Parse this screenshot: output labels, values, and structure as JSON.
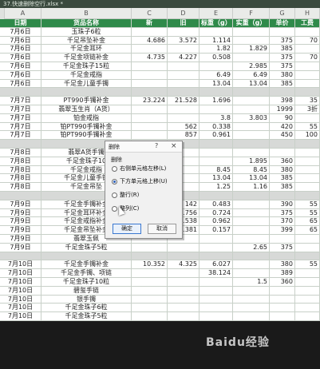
{
  "window": {
    "title": "37.快速删除空行.xlsx *"
  },
  "columns": [
    "A",
    "B",
    "C",
    "D",
    "E",
    "F",
    "G",
    "H"
  ],
  "header": [
    "日期",
    "货品名称",
    "新",
    "旧",
    "标重（g）",
    "实重（g）",
    "单价",
    "工费"
  ],
  "rows": [
    [
      "7月6日",
      "玉珠子6粒",
      "",
      "",
      "",
      "",
      "",
      ""
    ],
    [
      "7月6日",
      "千足吊坠补金",
      "4.686",
      "3.572",
      "1.114",
      "",
      "375",
      "70"
    ],
    [
      "7月6日",
      "千足金耳环",
      "",
      "",
      "1.82",
      "1.829",
      "385",
      ""
    ],
    [
      "7月6日",
      "千足金项链补金",
      "4.735",
      "4.227",
      "0.508",
      "",
      "375",
      "70"
    ],
    [
      "7月6日",
      "千足金珠子15粒",
      "",
      "",
      "",
      "2.985",
      "375",
      ""
    ],
    [
      "7月6日",
      "千足金戒指",
      "",
      "",
      "6.49",
      "6.49",
      "380",
      ""
    ],
    [
      "7月6日",
      "千足金儿童手镯",
      "",
      "",
      "13.04",
      "13.04",
      "385",
      ""
    ],
    [],
    [
      "7月7日",
      "PT990手镯补金",
      "23.224",
      "21.528",
      "1.696",
      "",
      "398",
      "35"
    ],
    [
      "7月7日",
      "翡翠玉生肖（A货）",
      "",
      "",
      "",
      "",
      "1999",
      "3折"
    ],
    [
      "7月7日",
      "铂金戒指",
      "",
      "",
      "3.8",
      "3.803",
      "90",
      ""
    ],
    [
      "7月7日",
      "铂PT990手镯补金",
      "",
      "562",
      "0.338",
      "",
      "420",
      "55"
    ],
    [
      "7月7日",
      "铂PT990手镯补金",
      "",
      "857",
      "0.961",
      "",
      "450",
      "100"
    ],
    [],
    [
      "7月8日",
      "翡翠A货手镯",
      "",
      "",
      "",
      "",
      "",
      ""
    ],
    [
      "7月8日",
      "千足金珠子10",
      "",
      "",
      "",
      "1.895",
      "360",
      ""
    ],
    [
      "7月8日",
      "千足金戒指",
      "",
      "",
      "8.45",
      "8.45",
      "380",
      ""
    ],
    [
      "7月8日",
      "千足金儿童手镯",
      "",
      "",
      "13.04",
      "13.04",
      "385",
      ""
    ],
    [
      "7月8日",
      "千足金吊坠",
      "",
      "",
      "1.25",
      "1.16",
      "385",
      ""
    ],
    [],
    [
      "7月9日",
      "千足金手镯补金",
      "",
      "142",
      "0.483",
      "",
      "390",
      "55"
    ],
    [
      "7月9日",
      "千足金耳环补金",
      "3.48",
      "2.756",
      "0.724",
      "",
      "375",
      "55"
    ],
    [
      "7月9日",
      "千足金戒指补金",
      "3.5",
      "2.538",
      "0.962",
      "",
      "370",
      "65"
    ],
    [
      "7月9日",
      "千足金吊坠补金",
      "14.538",
      "14.381",
      "0.157",
      "",
      "399",
      "65"
    ],
    [
      "7月9日",
      "翡翠玉佩",
      "",
      "",
      "",
      "",
      "",
      ""
    ],
    [
      "7月9日",
      "千足金珠子5粒",
      "",
      "",
      "",
      "2.65",
      "375",
      ""
    ],
    [],
    [
      "7月10日",
      "千足金手镯补金",
      "10.352",
      "4.325",
      "6.027",
      "",
      "380",
      "55"
    ],
    [
      "7月10日",
      "千足金手镯、项链",
      "",
      "",
      "38.124",
      "",
      "389",
      ""
    ],
    [
      "7月10日",
      "千足金珠子10粒",
      "",
      "",
      "",
      "1.5",
      "360",
      ""
    ],
    [
      "7月10日",
      "碧玺手链",
      "",
      "",
      "",
      "",
      "",
      ""
    ],
    [
      "7月10日",
      "银手镯",
      "",
      "",
      "",
      "",
      "",
      ""
    ],
    [
      "7月10日",
      "千足金珠子6粒",
      "",
      "",
      "",
      "",
      "",
      ""
    ],
    [
      "7月10日",
      "千足金珠子5粒",
      "",
      "",
      "",
      "",
      "",
      ""
    ]
  ],
  "dialog": {
    "title": "删除",
    "help": "?",
    "close": "×",
    "section": "删除",
    "options": [
      {
        "label": "右侧单元格左移(L)",
        "selected": false
      },
      {
        "label": "下方单元格上移(U)",
        "selected": true
      },
      {
        "label": "整行(R)",
        "selected": false
      },
      {
        "label": "整列(C)",
        "selected": false
      }
    ],
    "ok": "确定",
    "cancel": "取消"
  },
  "watermark": "Baidu经验",
  "colors": {
    "header_green": "#2f8a4a",
    "gap_gray": "#d7d9d7",
    "dialog_accent": "#3a78d0"
  }
}
